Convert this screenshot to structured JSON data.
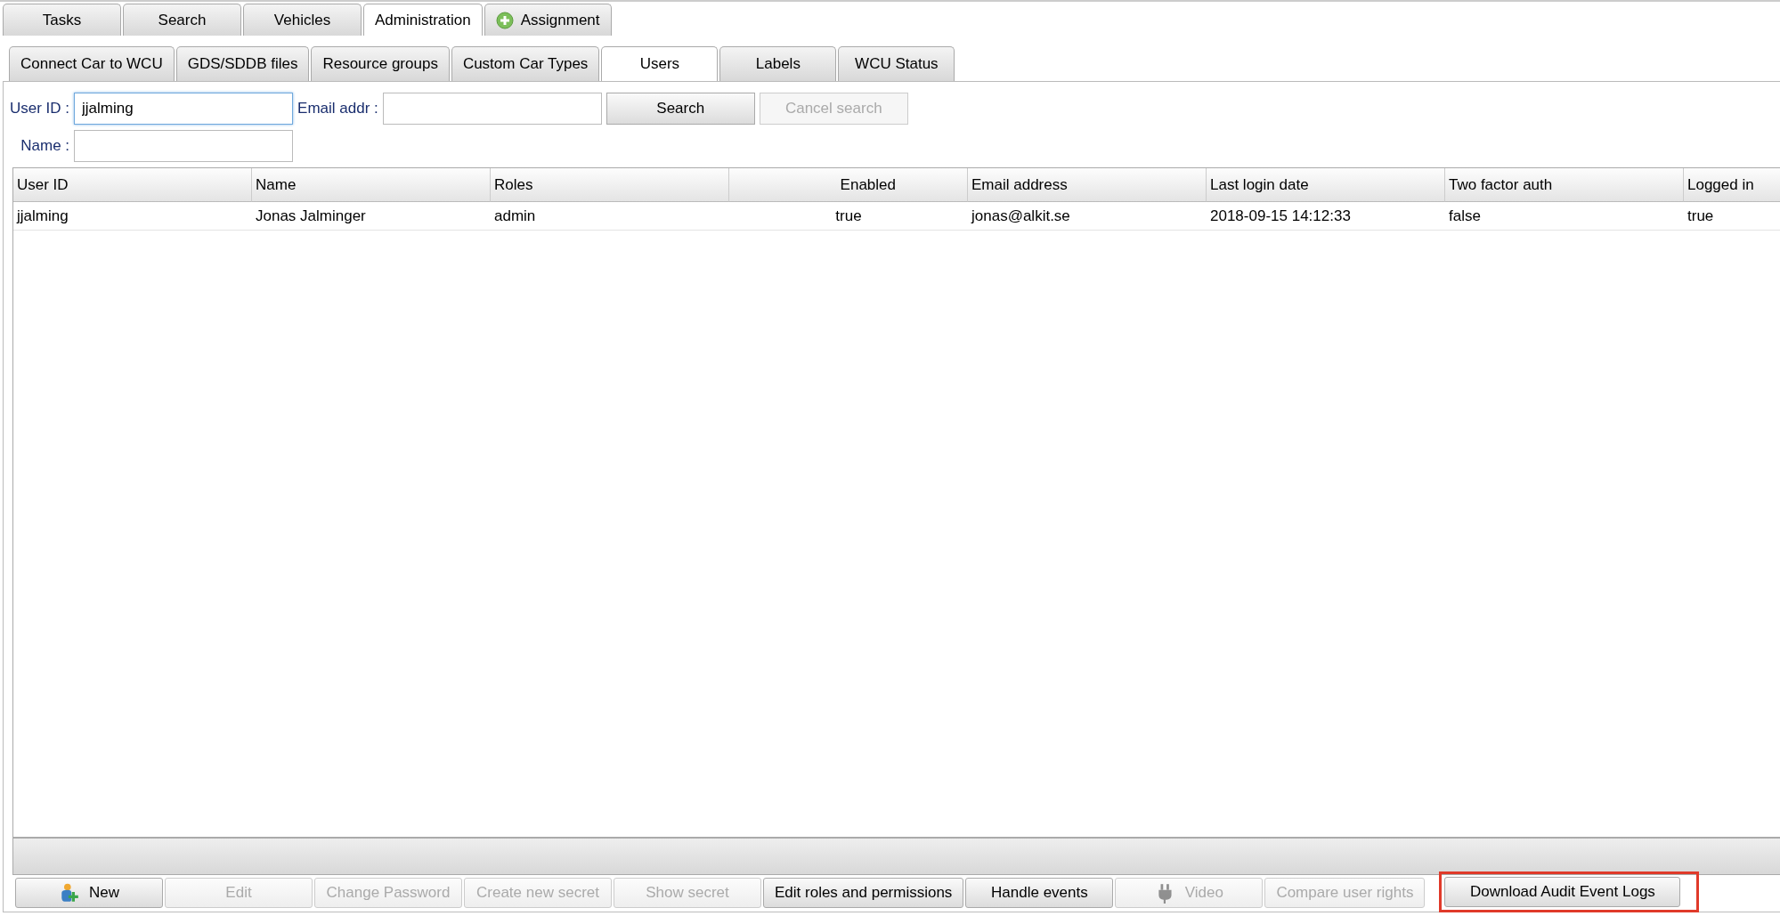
{
  "main_tabs": [
    {
      "label": "Tasks",
      "selected": false,
      "icon": false
    },
    {
      "label": "Search",
      "selected": false,
      "icon": false
    },
    {
      "label": "Vehicles",
      "selected": false,
      "icon": false
    },
    {
      "label": "Administration",
      "selected": true,
      "icon": false
    },
    {
      "label": "Assignment",
      "selected": false,
      "icon": true
    }
  ],
  "sub_tabs": [
    {
      "label": "Connect Car to WCU",
      "selected": false
    },
    {
      "label": "GDS/SDDB files",
      "selected": false
    },
    {
      "label": "Resource groups",
      "selected": false
    },
    {
      "label": "Custom Car Types",
      "selected": false
    },
    {
      "label": "Users",
      "selected": true
    },
    {
      "label": "Labels",
      "selected": false
    },
    {
      "label": "WCU Status",
      "selected": false
    }
  ],
  "search_form": {
    "user_id": {
      "label": "User ID :",
      "value": "jjalming"
    },
    "email": {
      "label": "Email addr :"
    },
    "name": {
      "label": "Name :"
    },
    "buttons": [
      {
        "label": "Search",
        "disabled": false
      },
      {
        "label": "Cancel search",
        "disabled": true
      }
    ]
  },
  "table": {
    "columns": [
      "User ID",
      "Name",
      "Roles",
      "Enabled",
      "Email address",
      "Last login date",
      "Two factor auth",
      "Logged in"
    ],
    "rows": [
      [
        "jjalming",
        "Jonas Jalminger",
        "admin",
        "true",
        "jonas@alkit.se",
        "2018-09-15 14:12:33",
        "false",
        "true"
      ]
    ]
  },
  "toolbar": [
    {
      "label": "New",
      "disabled": false,
      "kind": "new",
      "highlighted": false
    },
    {
      "label": "Edit",
      "disabled": true,
      "kind": "plain",
      "highlighted": false
    },
    {
      "label": "Change Password",
      "disabled": true,
      "kind": "plain",
      "highlighted": false
    },
    {
      "label": "Create new secret",
      "disabled": true,
      "kind": "plain",
      "highlighted": false
    },
    {
      "label": "Show secret",
      "disabled": true,
      "kind": "plain",
      "highlighted": false
    },
    {
      "label": "Edit roles and permissions",
      "disabled": false,
      "kind": "plain",
      "highlighted": false
    },
    {
      "label": "Handle events",
      "disabled": false,
      "kind": "plain",
      "highlighted": false
    },
    {
      "label": "Video",
      "disabled": true,
      "kind": "video",
      "highlighted": false
    },
    {
      "label": "Compare user rights",
      "disabled": true,
      "kind": "plain",
      "highlighted": false
    },
    {
      "label": "Download Audit Event Logs",
      "disabled": false,
      "kind": "plain",
      "highlighted": true
    }
  ]
}
